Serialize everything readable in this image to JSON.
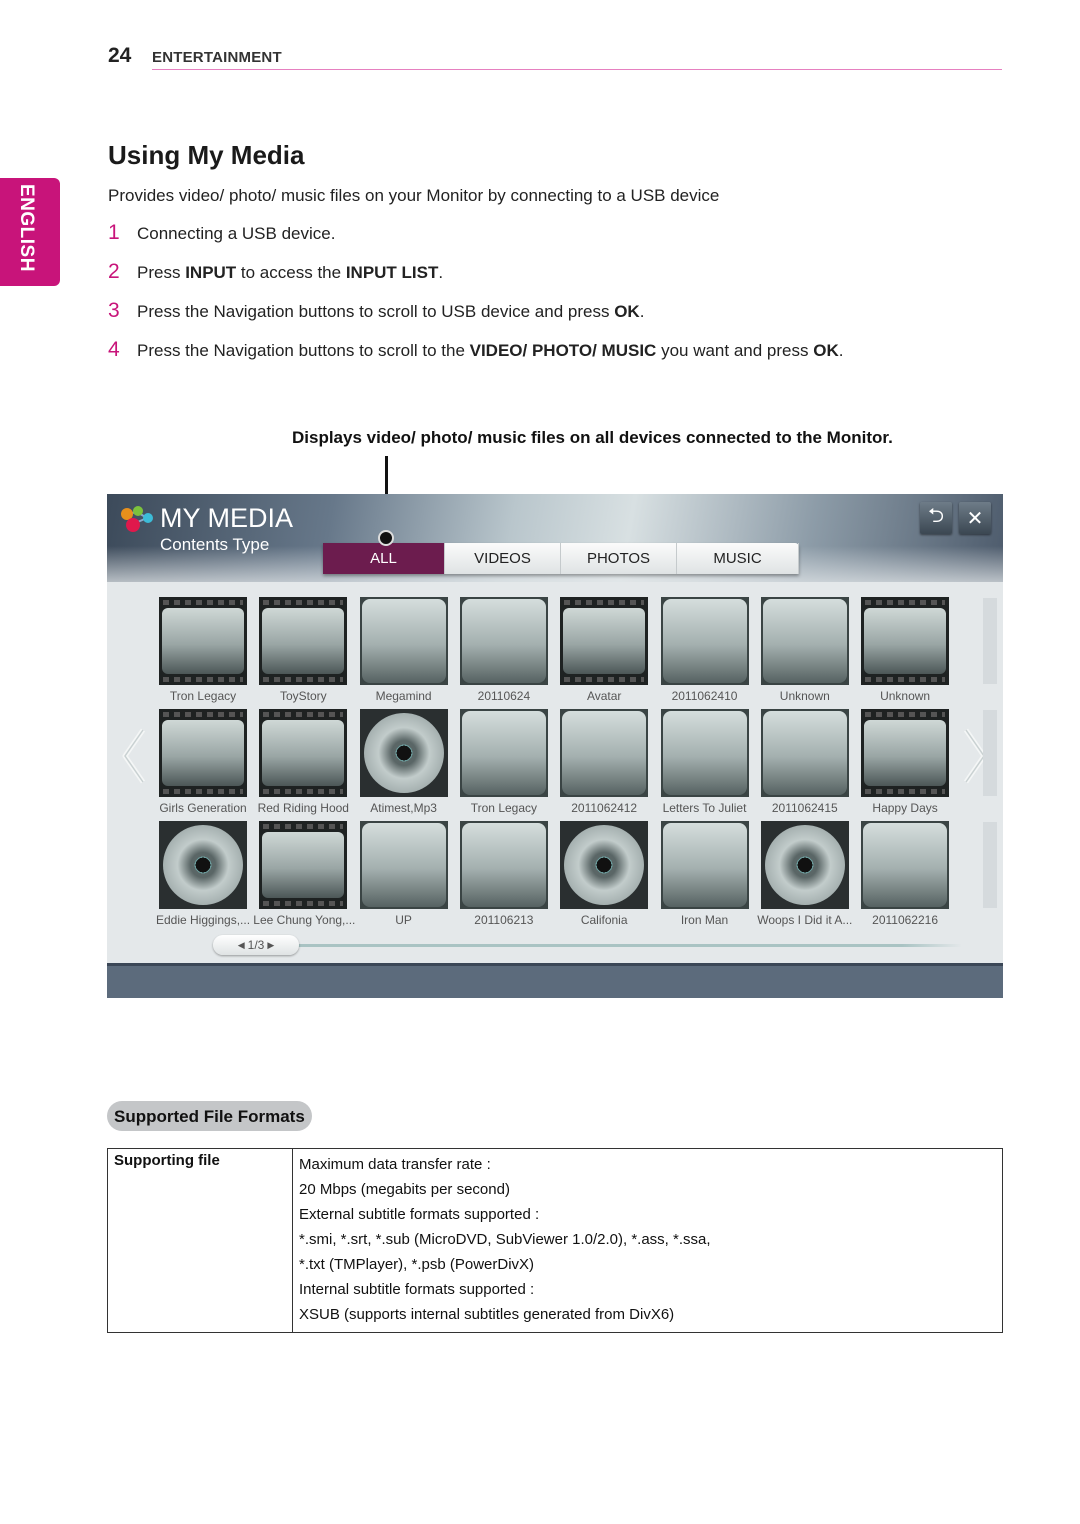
{
  "header": {
    "page_number": "24",
    "section": "ENTERTAINMENT"
  },
  "language_tab": "ENGLISH",
  "title": "Using My Media",
  "intro": "Provides video/ photo/ music files on your Monitor by connecting to a USB device",
  "steps": [
    {
      "num": "1",
      "parts": [
        {
          "t": "Connecting a USB device.",
          "b": false
        }
      ]
    },
    {
      "num": "2",
      "parts": [
        {
          "t": "Press ",
          "b": false
        },
        {
          "t": "INPUT",
          "b": true
        },
        {
          "t": " to access the ",
          "b": false
        },
        {
          "t": "INPUT LIST",
          "b": true
        },
        {
          "t": ".",
          "b": false
        }
      ]
    },
    {
      "num": "3",
      "parts": [
        {
          "t": "Press the Navigation buttons to scroll to USB device and press ",
          "b": false
        },
        {
          "t": "OK",
          "b": true
        },
        {
          "t": ".",
          "b": false
        }
      ]
    },
    {
      "num": "4",
      "parts": [
        {
          "t": "Press the Navigation buttons to scroll to the ",
          "b": false
        },
        {
          "t": "VIDEO/ PHOTO/ MUSIC",
          "b": true
        },
        {
          "t": " you want and press ",
          "b": false
        },
        {
          "t": "OK",
          "b": true
        },
        {
          "t": ".",
          "b": false
        }
      ]
    }
  ],
  "callout": "Displays video/ photo/ music files on all devices connected to the Monitor.",
  "my_media": {
    "app_title": "MY MEDIA",
    "subtitle": "Contents Type",
    "tabs": [
      {
        "label": "ALL",
        "active": true
      },
      {
        "label": "VIDEOS",
        "active": false
      },
      {
        "label": "PHOTOS",
        "active": false
      },
      {
        "label": "MUSIC",
        "active": false
      }
    ],
    "back_icon": "return-icon",
    "close_icon": "close-icon",
    "items": [
      {
        "label": "Tron Legacy",
        "type": "film"
      },
      {
        "label": "ToyStory",
        "type": "film"
      },
      {
        "label": "Megamind",
        "type": "plain"
      },
      {
        "label": "20110624",
        "type": "plain"
      },
      {
        "label": "Avatar",
        "type": "film"
      },
      {
        "label": "2011062410",
        "type": "plain"
      },
      {
        "label": "Unknown",
        "type": "plain"
      },
      {
        "label": "Unknown",
        "type": "film"
      },
      {
        "label": "Girls Generation",
        "type": "film"
      },
      {
        "label": "Red Riding Hood",
        "type": "film"
      },
      {
        "label": "Atimest,Mp3",
        "type": "disc"
      },
      {
        "label": "Tron Legacy",
        "type": "plain"
      },
      {
        "label": "2011062412",
        "type": "plain"
      },
      {
        "label": "Letters To Juliet",
        "type": "plain"
      },
      {
        "label": "2011062415",
        "type": "plain"
      },
      {
        "label": "Happy Days",
        "type": "film"
      },
      {
        "label": "Eddie Higgings,...",
        "type": "disc"
      },
      {
        "label": "Lee Chung Yong,...",
        "type": "film"
      },
      {
        "label": "UP",
        "type": "plain"
      },
      {
        "label": "201106213",
        "type": "plain"
      },
      {
        "label": "Califonia",
        "type": "disc"
      },
      {
        "label": "Iron Man",
        "type": "plain"
      },
      {
        "label": "Woops I Did it A...",
        "type": "disc"
      },
      {
        "label": "2011062216",
        "type": "plain"
      }
    ],
    "pager": "1/3",
    "colors": {
      "active_tab": "#6c1c4e",
      "bottom_bar": "#5c6b7c"
    }
  },
  "formats": {
    "section_title": "Supported File Formats",
    "row_header": "Supporting file",
    "lines": [
      "Maximum data transfer rate :",
      "20 Mbps (megabits per second)",
      "External subtitle formats supported :",
      "*.smi, *.srt, *.sub (MicroDVD, SubViewer 1.0/2.0), *.ass, *.ssa,",
      "*.txt (TMPlayer), *.psb (PowerDivX)",
      "Internal subtitle formats supported :",
      "XSUB (supports internal subtitles generated from DivX6)"
    ]
  },
  "colors": {
    "accent": "#c8147a",
    "header_rule": "#e680c0"
  }
}
